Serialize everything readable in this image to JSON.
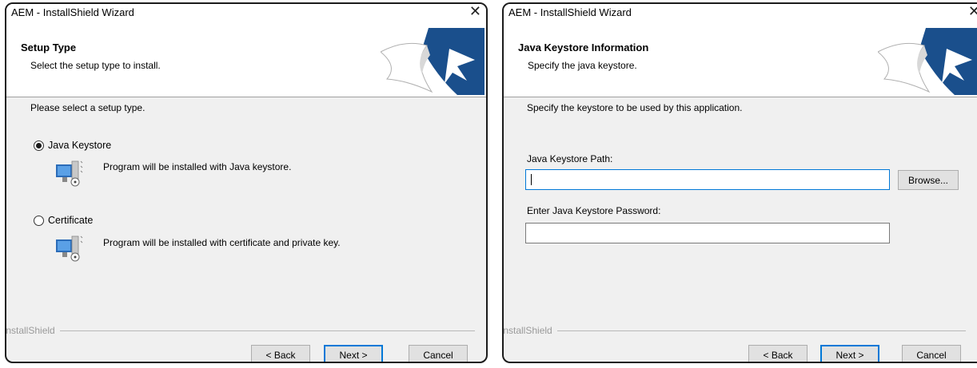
{
  "left_dialog": {
    "title": "AEM - InstallShield Wizard",
    "header_title": "Setup Type",
    "header_subtitle": "Select the setup type to install.",
    "prompt": "Please select a setup type.",
    "options": [
      {
        "label": "Java Keystore",
        "description": "Program will be installed with Java keystore.",
        "selected": true
      },
      {
        "label": "Certificate",
        "description": "Program will be installed with certificate and private key.",
        "selected": false
      }
    ],
    "branding": "InstallShield",
    "buttons": {
      "back": "< Back",
      "next": "Next >",
      "cancel": "Cancel"
    }
  },
  "right_dialog": {
    "title": "AEM - InstallShield Wizard",
    "header_title": "Java Keystore Information",
    "header_subtitle": "Specify the java keystore.",
    "prompt": "Specify the keystore to be used by this application.",
    "path_label": "Java Keystore Path:",
    "path_value": "",
    "browse_label": "Browse...",
    "password_label": "Enter Java Keystore Password:",
    "password_value": "",
    "branding": "InstallShield",
    "buttons": {
      "back": "< Back",
      "next": "Next >",
      "cancel": "Cancel"
    }
  },
  "icons": {
    "close": "close-icon",
    "logo": "installshield-logo",
    "computer": "computer-install-icon"
  },
  "colors": {
    "logo_blue": "#1a4f8c",
    "focus_border": "#0078d7",
    "branding_gray": "#9a9a9a"
  }
}
